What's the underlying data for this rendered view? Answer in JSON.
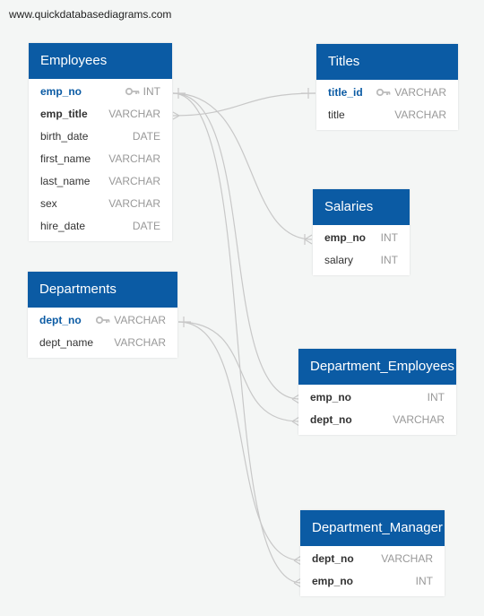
{
  "watermark": "www.quickdatabasediagrams.com",
  "colors": {
    "header": "#0b5ba4",
    "link": "#c8c8c8"
  },
  "tables": {
    "employees": {
      "name": "Employees",
      "columns": [
        {
          "name": "emp_no",
          "type": "INT",
          "pk": true
        },
        {
          "name": "emp_title",
          "type": "VARCHAR",
          "fk": true
        },
        {
          "name": "birth_date",
          "type": "DATE"
        },
        {
          "name": "first_name",
          "type": "VARCHAR"
        },
        {
          "name": "last_name",
          "type": "VARCHAR"
        },
        {
          "name": "sex",
          "type": "VARCHAR"
        },
        {
          "name": "hire_date",
          "type": "DATE"
        }
      ]
    },
    "titles": {
      "name": "Titles",
      "columns": [
        {
          "name": "title_id",
          "type": "VARCHAR",
          "pk": true
        },
        {
          "name": "title",
          "type": "VARCHAR"
        }
      ]
    },
    "salaries": {
      "name": "Salaries",
      "columns": [
        {
          "name": "emp_no",
          "type": "INT",
          "fk": true
        },
        {
          "name": "salary",
          "type": "INT"
        }
      ]
    },
    "departments": {
      "name": "Departments",
      "columns": [
        {
          "name": "dept_no",
          "type": "VARCHAR",
          "pk": true
        },
        {
          "name": "dept_name",
          "type": "VARCHAR"
        }
      ]
    },
    "dept_emp": {
      "name": "Department_Employees",
      "columns": [
        {
          "name": "emp_no",
          "type": "INT",
          "fk": true
        },
        {
          "name": "dept_no",
          "type": "VARCHAR",
          "fk": true
        }
      ]
    },
    "dept_manager": {
      "name": "Department_Manager",
      "columns": [
        {
          "name": "dept_no",
          "type": "VARCHAR",
          "fk": true
        },
        {
          "name": "emp_no",
          "type": "INT",
          "fk": true
        }
      ]
    }
  }
}
